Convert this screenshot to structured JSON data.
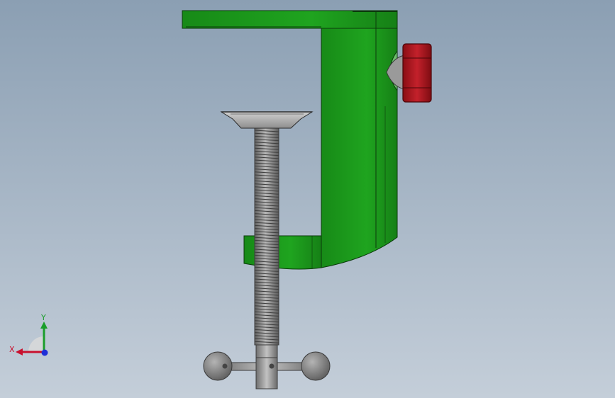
{
  "viewport": {
    "background_top": "#8b9fb3",
    "background_bottom": "#c4ced9"
  },
  "model": {
    "frame_color": "#1d9a1d",
    "knob_color": "#b0161e",
    "screw_color": "#8a8a8a",
    "handle_color": "#7c7c7c"
  },
  "triad": {
    "x_label": "X",
    "y_label": "Y",
    "x_color": "#c8102e",
    "y_color": "#1a9e2a",
    "z_color": "#1f2fd6"
  }
}
